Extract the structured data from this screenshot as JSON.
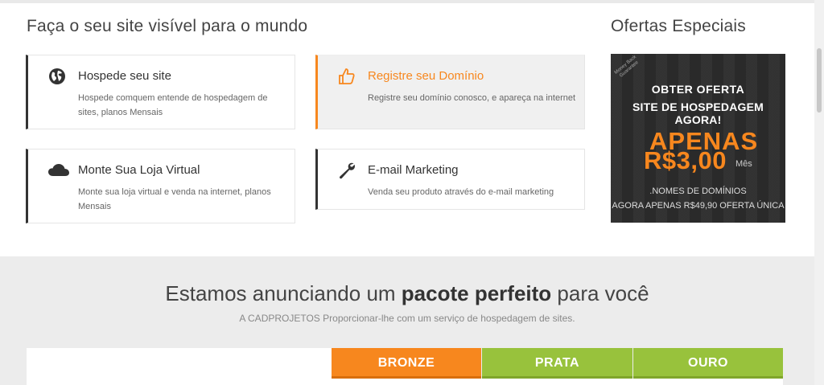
{
  "main": {
    "title": "Faça o seu site visível para o mundo",
    "features": [
      {
        "title": "Hospede seu site",
        "desc": "Hospede comquem entende de hospedagem de sites, planos Mensais",
        "icon": "globe-icon"
      },
      {
        "title": "Registre seu Domínio",
        "desc": "Registre seu domínio conosco, e apareça na internet",
        "icon": "thumbs-up-icon"
      },
      {
        "title": "Monte Sua Loja Virtual",
        "desc": "Monte sua loja virtual e venda na internet, planos Mensais",
        "icon": "cloud-icon"
      },
      {
        "title": "E-mail Marketing",
        "desc": "Venda seu produto através do e-mail marketing",
        "icon": "wrench-icon"
      }
    ]
  },
  "offers": {
    "title": "Ofertas Especiais",
    "badge": "Money Back Guarantee",
    "line1": "OBTER OFERTA",
    "line2": "SITE DE HOSPEDAGEM AGORA!",
    "apenas": "APENAS",
    "price": "R$3,00",
    "period": "Mês",
    "line3": ".NOMES DE DOMÍNIOS",
    "line4": "AGORA APENAS R$49,90 OFERTA ÚNICA"
  },
  "pricing": {
    "headline_pre": "Estamos anunciando um",
    "headline_bold": "pacote perfeito",
    "headline_post": "para você",
    "subline": "A CADPROJETOS Proporcionar-lhe com um serviço de hospedagem de sites.",
    "plans": [
      "BRONZE",
      "PRATA",
      "OURO"
    ]
  },
  "colors": {
    "accent": "#f7871e",
    "green": "#98c23c",
    "dark": "#2c2c2c"
  }
}
